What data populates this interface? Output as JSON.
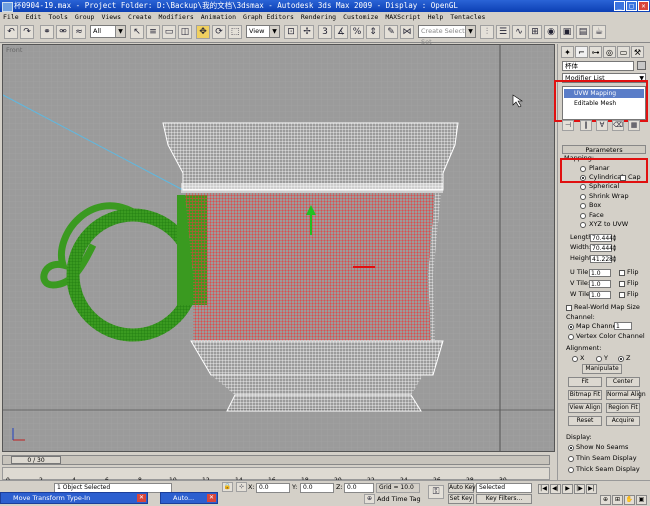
{
  "window": {
    "title": "杯0904-19.max    - Project Folder: D:\\Backup\\我的文档\\3dsmax    - Autodesk 3ds Max  2009    - Display : OpenGL"
  },
  "menu": [
    "File",
    "Edit",
    "Tools",
    "Group",
    "Views",
    "Create",
    "Modifiers",
    "Animation",
    "Graph Editors",
    "Rendering",
    "Customize",
    "MAXScript",
    "Help",
    "Tentacles"
  ],
  "toolbar": {
    "filter": "All",
    "refcoord": "View",
    "selection_set": "Create Selection Set"
  },
  "viewport": {
    "label": "Front"
  },
  "command_panel": {
    "object_name": "杯体",
    "modifier_list": "Modifier List",
    "stack": [
      "UVW Mapping",
      "Editable Mesh"
    ],
    "parameters_rollout": "Parameters",
    "mapping_label": "Mapping:",
    "mapping_options": [
      "Planar",
      "Cylindrical",
      "Spherical",
      "Shrink Wrap",
      "Box",
      "Face",
      "XYZ to UVW"
    ],
    "mapping_selected": "Cylindrical",
    "cap_label": "Cap",
    "length_label": "Length:",
    "length": "70.444",
    "width_label": "Width:",
    "width": "70.444",
    "height_label": "Height:",
    "height": "41.228",
    "utile_label": "U Tile:",
    "utile": "1.0",
    "vtile_label": "V Tile:",
    "vtile": "1.0",
    "wtile_label": "W Tile:",
    "wtile": "1.0",
    "flip_label": "Flip",
    "real_world": "Real-World Map Size",
    "channel_label": "Channel:",
    "map_channel": "Map Channel:",
    "map_channel_value": "1",
    "vertex_color": "Vertex Color Channel",
    "alignment_label": "Alignment:",
    "axes": [
      "X",
      "Y",
      "Z"
    ],
    "axis_selected": "Z",
    "manipulate": "Manipulate",
    "buttons": [
      [
        "Fit",
        "Center"
      ],
      [
        "Bitmap Fit",
        "Normal Align"
      ],
      [
        "View Align",
        "Region Fit"
      ],
      [
        "Reset",
        "Acquire"
      ]
    ],
    "display_label": "Display:",
    "display_options": [
      "Show No Seams",
      "Thin Seam Display",
      "Thick Seam Display"
    ],
    "display_selected": "Show No Seams"
  },
  "timeline": {
    "frame_display": "0 / 30",
    "ticks": [
      "0",
      "2",
      "4",
      "6",
      "8",
      "10",
      "12",
      "14",
      "16",
      "18",
      "20",
      "22",
      "24",
      "26",
      "28",
      "30"
    ]
  },
  "status": {
    "selected_text": "1 Object Selected",
    "x_label": "X:",
    "x": "0.0",
    "y_label": "Y:",
    "y": "0.0",
    "z_label": "Z:",
    "z": "0.0",
    "grid": "Grid = 10.0",
    "add_time_tag": "Add Time Tag",
    "auto_key": "Auto Key",
    "set_key": "Set Key",
    "key_mode": "Selected",
    "key_filters": "Key Filters...",
    "tasks": [
      "Move Transform Type-In",
      "Auto..."
    ]
  }
}
